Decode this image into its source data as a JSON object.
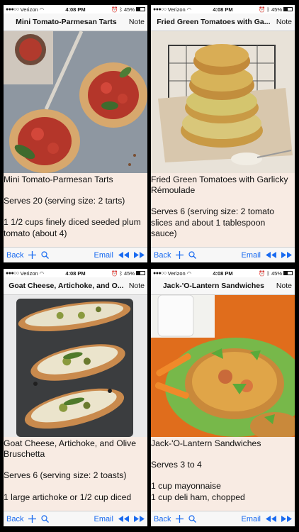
{
  "status": {
    "carrier": "Verizon",
    "time": "4:08 PM",
    "battery": "45%"
  },
  "toolbar": {
    "back": "Back",
    "email": "Email"
  },
  "colors": {
    "accent": "#1a6bf0",
    "content_bg": "#f8ebe3"
  },
  "screens": [
    {
      "title": "Mini Tomato-Parmesan Tarts",
      "note": "Note",
      "lines": [
        "Mini Tomato-Parmesan Tarts",
        "Serves 20 (serving size: 2 tarts)",
        "1 1/2 cups finely diced seeded plum tomato (about 4)"
      ]
    },
    {
      "title": "Fried Green Tomatoes with Ga...",
      "note": "Note",
      "lines": [
        "Fried Green Tomatoes with Garlicky Rémoulade",
        "Serves 6 (serving size: 2 tomato slices and about 1 tablespoon sauce)"
      ]
    },
    {
      "title": "Goat Cheese, Artichoke, and O...",
      "note": "Note",
      "lines": [
        "Goat Cheese, Artichoke, and Olive Bruschetta",
        "Serves 6 (serving size: 2 toasts)",
        "1 large artichoke or 1/2 cup diced"
      ]
    },
    {
      "title": "Jack-'O-Lantern Sandwiches",
      "note": "Note",
      "lines": [
        "Jack-'O-Lantern Sandwiches",
        "Serves 3 to 4",
        "1 cup mayonnaise\n1 cup deli ham, chopped"
      ]
    }
  ]
}
